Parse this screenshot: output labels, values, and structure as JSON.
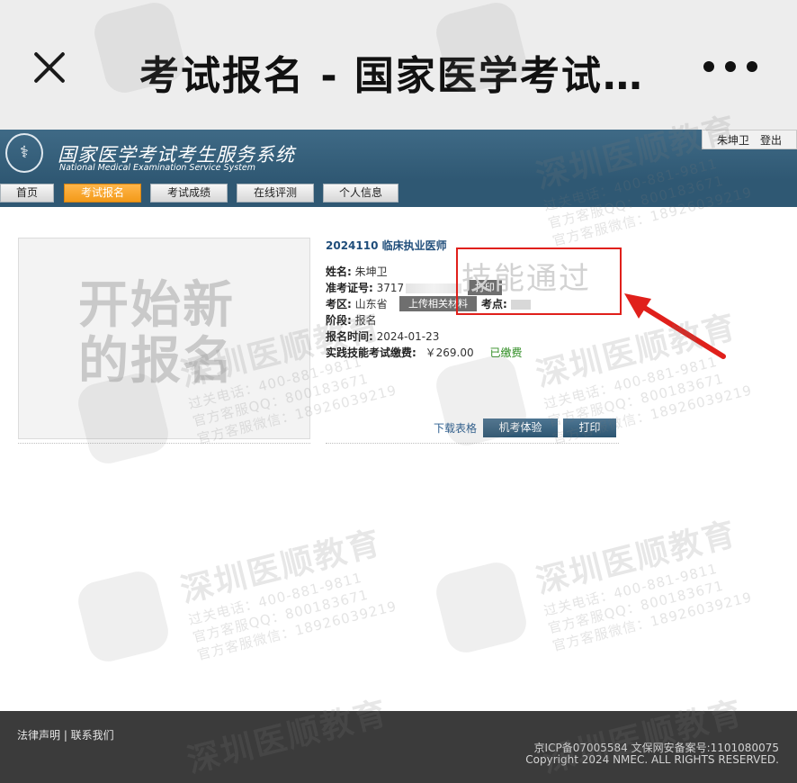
{
  "wechat": {
    "title": "考试报名 - 国家医学考试…"
  },
  "header": {
    "logo_icon": "caduceus-emblem-icon",
    "title": "国家医学考试考生服务系统",
    "subtitle": "National Medical Examination Service System",
    "user_name": "朱坤卫",
    "logout_label": "登出"
  },
  "nav": {
    "items": [
      {
        "label": "首页",
        "active": false
      },
      {
        "label": "考试报名",
        "active": true
      },
      {
        "label": "考试成绩",
        "active": false
      },
      {
        "label": "在线评测",
        "active": false
      },
      {
        "label": "个人信息",
        "active": false
      }
    ],
    "active_color": "#f39a19"
  },
  "main": {
    "photo_placeholder": "开始新的报名",
    "exam_title": "2024110 临床执业医师",
    "fields": {
      "name_label": "姓名:",
      "name_value": "朱坤卫",
      "ticket_label": "准考证号:",
      "ticket_value": "3717",
      "print_small": "打印",
      "region_label": "考区:",
      "region_value": "山东省",
      "upload_label": "上传相关材料",
      "site_label": "考点:",
      "stage_label": "阶段:",
      "stage_value": "报名",
      "date_label": "报名时间:",
      "date_value": "2024-01-23",
      "fee_label": "实践技能考试缴费:",
      "fee_value": "￥269.00",
      "fee_status": "已缴费"
    },
    "highlight_text": "技能通过",
    "actions": {
      "download": "下载表格",
      "trial": "机考体验",
      "print": "打印"
    }
  },
  "footer": {
    "links": "法律声明 | 联系我们",
    "icp": "京ICP备07005584 文保网安备案号:1101080075",
    "copyright": "Copyright 2024 NMEC. ALL RIGHTS RESERVED."
  },
  "watermark": {
    "brand": "深圳医顺教育",
    "phone": "过关电话：400-881-9811",
    "qq": "官方客服QQ：800183671",
    "wechat": "官方客服微信：18926039219"
  },
  "colors": {
    "header_blue": "#2f5873",
    "highlight_red": "#e0201b",
    "paid_green": "#2c8a1f"
  }
}
